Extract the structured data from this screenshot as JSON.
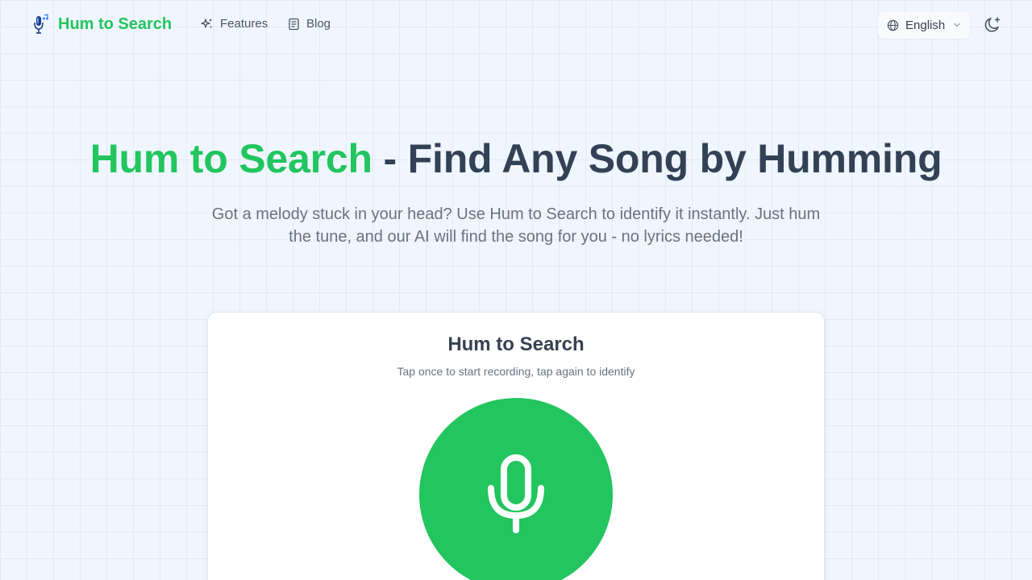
{
  "colors": {
    "brand": "#22c55e",
    "heading": "#334155",
    "muted": "#6b7280",
    "background": "#eff6ff"
  },
  "nav": {
    "brand_name": "Hum to Search",
    "brand_icon": "microphone-music-icon",
    "links": [
      {
        "label": "Features",
        "icon": "sparkles-icon"
      },
      {
        "label": "Blog",
        "icon": "document-icon"
      }
    ],
    "language": {
      "label": "English",
      "icon": "globe-icon"
    },
    "theme_icon": "moon-star-icon"
  },
  "hero": {
    "title_accent": "Hum to Search",
    "title_rest": " - Find Any Song by Humming",
    "subtitle": "Got a melody stuck in your head? Use Hum to Search to identify it instantly. Just hum the tune, and our AI will find the song for you - no lyrics needed!"
  },
  "recorder": {
    "title": "Hum to Search",
    "instructions": "Tap once to start recording, tap again to identify",
    "button_icon": "microphone-icon"
  }
}
